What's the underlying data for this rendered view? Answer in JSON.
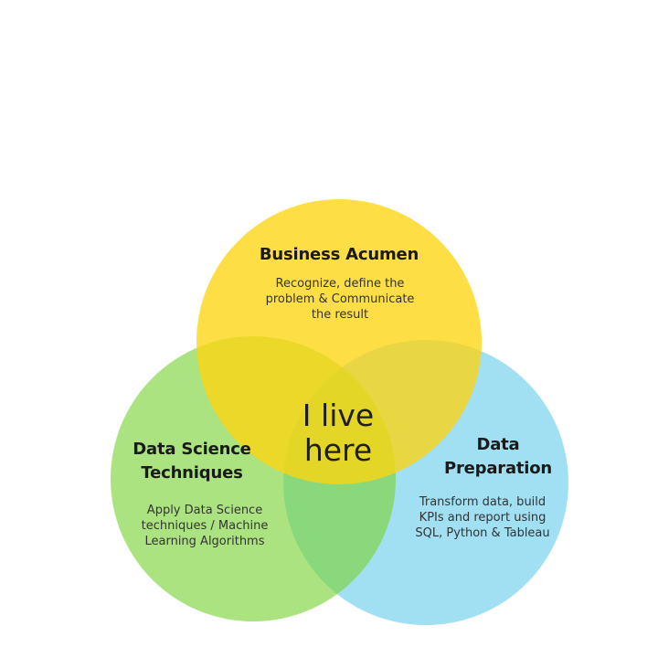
{
  "circles": [
    {
      "id": "business-acumen",
      "title": "Business Acumen",
      "description": "Recognize, define the\nproblem & Communicate\nthe result",
      "color": "#FCD50F"
    },
    {
      "id": "data-science-techniques",
      "title": "Data Science\nTechniques",
      "description": "Apply Data Science\ntechniques / Machine\nLearning Algorithms",
      "color": "#7ED43C"
    },
    {
      "id": "data-preparation",
      "title": "Data\nPreparation",
      "description": "Transform data, build\nKPIs and report using\nSQL, Python & Tableau",
      "color": "#7DD3EE"
    }
  ],
  "center_label": "I live\nhere"
}
